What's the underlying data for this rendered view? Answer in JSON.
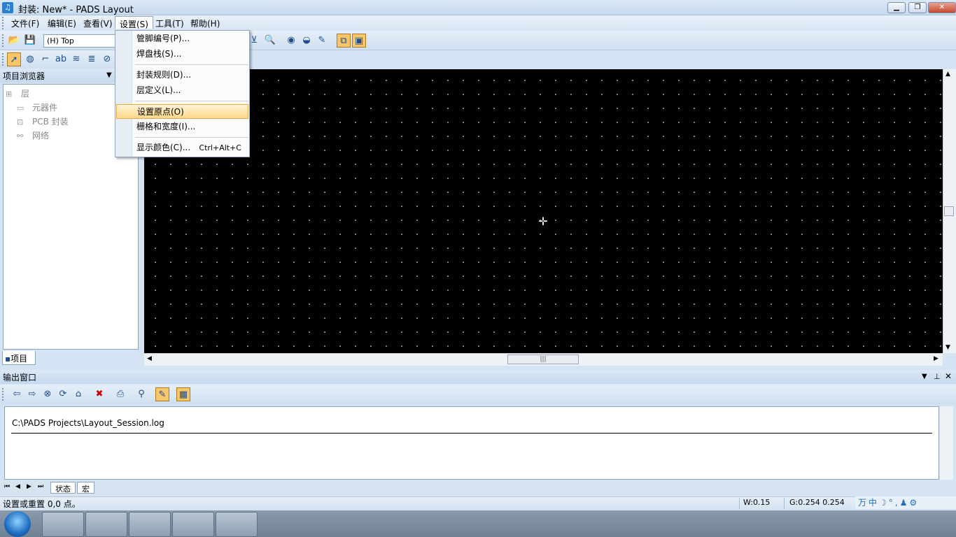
{
  "window": {
    "icon": "pads-app-icon",
    "title": "封装: New* - PADS Layout",
    "minimize_icon": "minimize-icon",
    "restore_icon": "restore-icon",
    "close_icon": "close-icon"
  },
  "menubar": {
    "items": [
      "文件(F)",
      "编辑(E)",
      "查看(V)",
      "设置(S)",
      "工具(T)",
      "帮助(H)"
    ],
    "active_index": 3
  },
  "toolbar": {
    "layer_select": "(H) Top"
  },
  "setup_menu": {
    "items": [
      {
        "label": "管脚编号(P)...",
        "shortcut": ""
      },
      {
        "label": "焊盘栈(S)...",
        "shortcut": ""
      },
      {
        "label": "封装规则(D)...",
        "shortcut": ""
      },
      {
        "label": "层定义(L)...",
        "shortcut": ""
      },
      {
        "label": "设置原点(O)",
        "shortcut": ""
      },
      {
        "label": "栅格和宽度(I)...",
        "shortcut": ""
      },
      {
        "label": "显示颜色(C)...",
        "shortcut": "Ctrl+Alt+C"
      }
    ],
    "highlighted_index": 4
  },
  "project_browser": {
    "title": "项目浏览器",
    "tree": [
      "层",
      "元器件",
      "PCB 封装",
      "网络"
    ],
    "tab": "项目"
  },
  "canvas": {
    "background": "#000000",
    "origin_icon": "origin-crosshair-icon"
  },
  "output": {
    "title": "输出窗口",
    "log_path": "C:\\PADS Projects\\Layout_Session.log",
    "tabs": [
      "状态",
      "宏"
    ]
  },
  "statusbar": {
    "message": "设置或重置 0,0 点。",
    "width": "W:0.15",
    "grid": "G:0.254 0.254"
  },
  "ime": {
    "text": "万中"
  },
  "colors": {
    "menu_highlight": "#ffd88a",
    "pressed_button": "#f7c56a",
    "title_bar": "#c7daef"
  }
}
